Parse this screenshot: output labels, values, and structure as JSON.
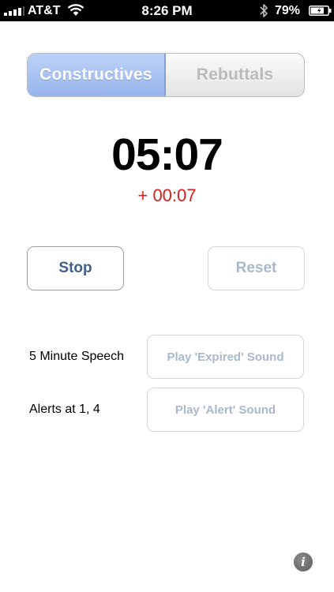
{
  "status_bar": {
    "carrier": "AT&T",
    "time": "8:26 PM",
    "battery_percent": "79%",
    "signal_bars": 4,
    "icons": [
      "signal-icon",
      "wifi-icon",
      "bluetooth-icon",
      "battery-icon"
    ]
  },
  "segmented_control": {
    "segments": [
      "Constructives",
      "Rebuttals"
    ],
    "selected": "Constructives"
  },
  "timer": {
    "remaining": "05:07",
    "overtime": "+ 00:07"
  },
  "controls": {
    "stop_label": "Stop",
    "reset_label": "Reset"
  },
  "info": {
    "speech_label": "5 Minute Speech",
    "alerts_label": "Alerts at 1, 4",
    "play_expired_label": "Play 'Expired' Sound",
    "play_alert_label": "Play 'Alert' Sound"
  },
  "info_button": {
    "glyph": "i"
  },
  "colors": {
    "selected_segment": "#9db9ee",
    "overtime_text": "#e21a1a",
    "button_text_active": "#3f5f8c",
    "button_text_disabled": "#a9b8cf"
  }
}
